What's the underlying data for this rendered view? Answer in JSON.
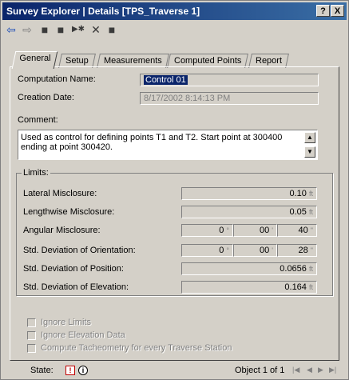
{
  "window": {
    "title": "Survey Explorer | Details [TPS_Traverse 1]",
    "help_button": "?",
    "close_button": "X"
  },
  "toolbar": {
    "icons": [
      "back-arrow-icon",
      "forward-arrow-icon",
      "save-icon",
      "new-icon",
      "rename-icon",
      "delete-icon",
      "properties-icon"
    ]
  },
  "tabs": [
    {
      "label": "General",
      "active": true
    },
    {
      "label": "Setup",
      "active": false
    },
    {
      "label": "Measurements",
      "active": false
    },
    {
      "label": "Computed Points",
      "active": false
    },
    {
      "label": "Report",
      "active": false
    }
  ],
  "general": {
    "computation_name_label": "Computation Name:",
    "computation_name_value": "Control 01",
    "creation_date_label": "Creation Date:",
    "creation_date_value": "8/17/2002 8:14:13 PM",
    "comment_label": "Comment:",
    "comment_value": "Used as control for defining points T1 and T2. Start point at 300400 ending at point 300420."
  },
  "limits": {
    "group_label": "Limits:",
    "lateral_label": "Lateral Misclosure:",
    "lateral_value": "0.10",
    "lateral_unit": "ft",
    "lengthwise_label": "Lengthwise Misclosure:",
    "lengthwise_value": "0.05",
    "lengthwise_unit": "ft",
    "angular_label": "Angular Misclosure:",
    "angular_deg": "0",
    "angular_min": "00",
    "angular_sec": "40",
    "orientation_label": "Std. Deviation of Orientation:",
    "orientation_deg": "0",
    "orientation_min": "00",
    "orientation_sec": "28",
    "position_label": "Std. Deviation of Position:",
    "position_value": "0.0656",
    "position_unit": "ft",
    "elevation_label": "Std. Deviation of Elevation:",
    "elevation_value": "0.164",
    "elevation_unit": "ft",
    "deg_symbol": "°",
    "min_symbol": "'",
    "sec_symbol": "\""
  },
  "options": {
    "ignore_limits": "Ignore Limits",
    "ignore_elevation": "Ignore Elevation Data",
    "compute_tacheometry": "Compute Tacheometry for every Traverse Station"
  },
  "status": {
    "state_label": "State:",
    "object_text": "Object 1 of 1"
  }
}
